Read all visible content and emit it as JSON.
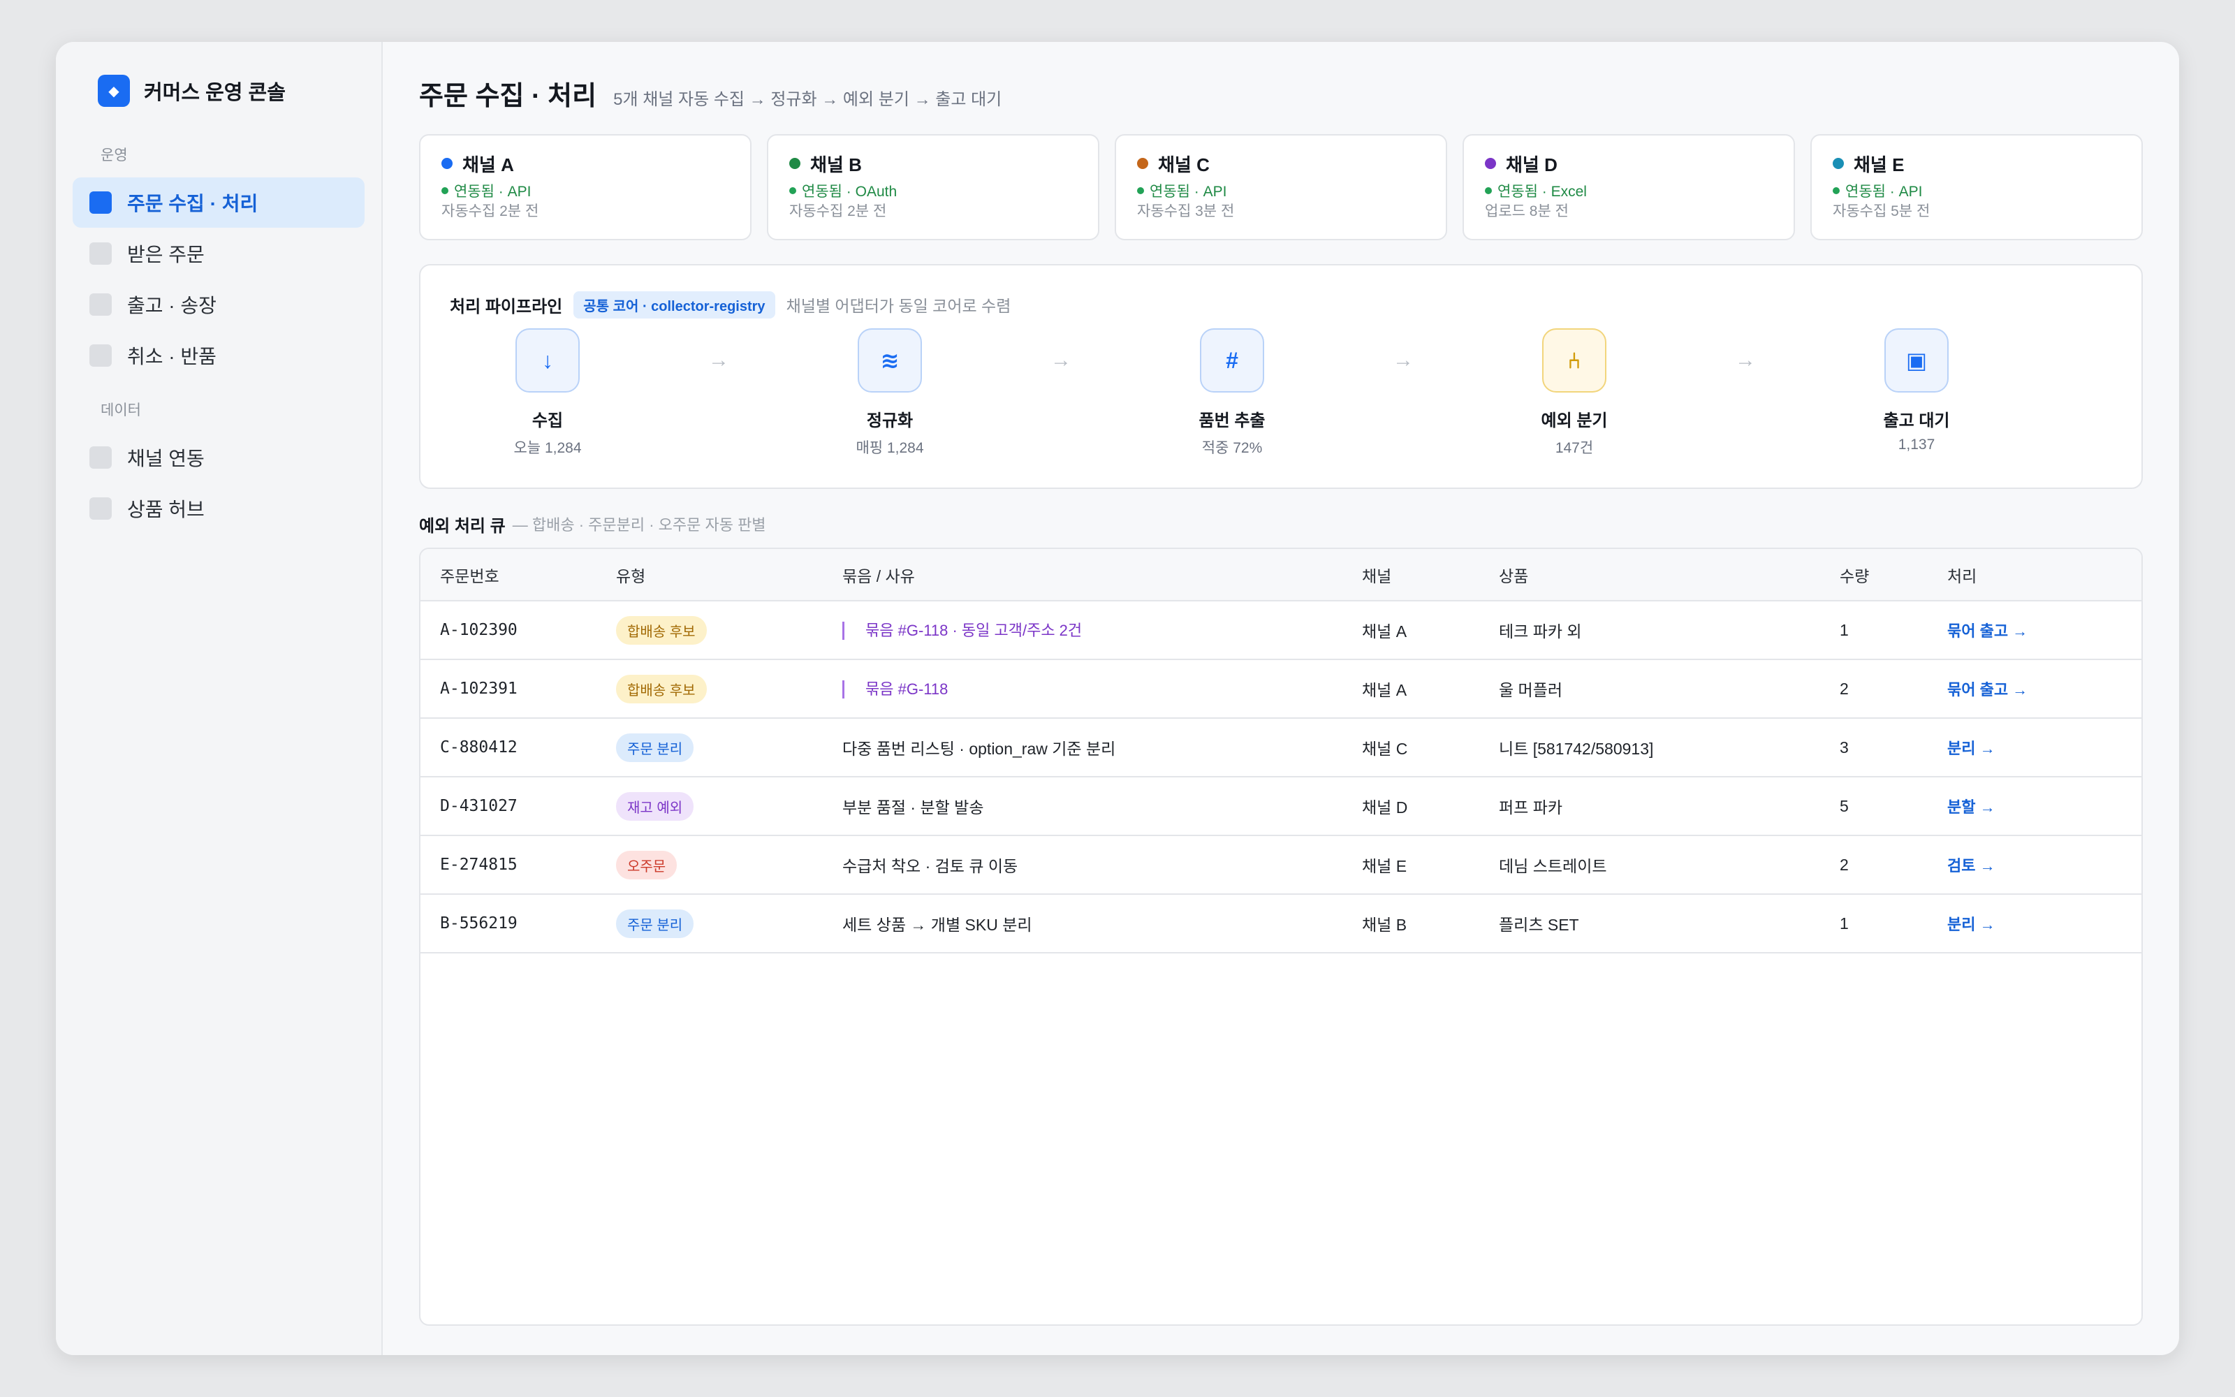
{
  "app": {
    "name": "커머스 운영 콘솔",
    "logo_glyph": "◆"
  },
  "sidebar": {
    "groups": [
      {
        "label": "운영",
        "items": [
          {
            "label": "주문 수집 · 처리",
            "active": true
          },
          {
            "label": "받은 주문",
            "active": false
          },
          {
            "label": "출고 · 송장",
            "active": false
          },
          {
            "label": "취소 · 반품",
            "active": false
          }
        ]
      },
      {
        "label": "데이터",
        "items": [
          {
            "label": "채널 연동",
            "active": false
          },
          {
            "label": "상품 허브",
            "active": false
          }
        ]
      }
    ]
  },
  "header": {
    "title": "주문 수집 · 처리",
    "subtitle": "5개 채널 자동 수집 → 정규화 → 예외 분기 → 출고 대기"
  },
  "channels": [
    {
      "name": "채널 A",
      "color": "#1a6cf2",
      "status": "연동됨 · API",
      "time": "자동수집 2분 전"
    },
    {
      "name": "채널 B",
      "color": "#1f8a45",
      "status": "연동됨 · OAuth",
      "time": "자동수집 2분 전"
    },
    {
      "name": "채널 C",
      "color": "#c4661a",
      "status": "연동됨 · API",
      "time": "자동수집 3분 전"
    },
    {
      "name": "채널 D",
      "color": "#7b35c7",
      "status": "연동됨 · Excel",
      "time": "업로드 8분 전"
    },
    {
      "name": "채널 E",
      "color": "#1a8fb5",
      "status": "연동됨 · API",
      "time": "자동수집 5분 전"
    }
  ],
  "pipeline": {
    "title": "처리 파이프라인",
    "tag": "공통 코어 · collector-registry",
    "desc": "채널별 어댑터가 동일 코어로 수렴",
    "arrow_glyph": "→",
    "stages": [
      {
        "label": "수집",
        "sub": "오늘 1,284",
        "icon": "download-icon",
        "glyph": "↓"
      },
      {
        "label": "정규화",
        "sub": "매핑 1,284",
        "icon": "normalize-icon",
        "glyph": "≋"
      },
      {
        "label": "품번 추출",
        "sub": "적중 72%",
        "icon": "hash-icon",
        "glyph": "#"
      },
      {
        "label": "예외 분기",
        "sub": "147건",
        "icon": "branch-icon",
        "glyph": "⑃"
      },
      {
        "label": "출고 대기",
        "sub": "1,137",
        "icon": "box-icon",
        "glyph": "▣"
      }
    ]
  },
  "queue": {
    "title": "예외 처리 큐",
    "subtitle": "— 합배송 · 주문분리 · 오주문 자동 판별",
    "columns": [
      "주문번호",
      "유형",
      "묶음 / 사유",
      "채널",
      "상품",
      "수량",
      "처리"
    ],
    "rows": [
      {
        "id": "A-102390",
        "type": "합배송 후보",
        "type_style": "yellow",
        "reason": "묶음 #G-118 · 동일 고객/주소 2건",
        "grouped": true,
        "channel": "채널 A",
        "product": "테크 파카 외",
        "qty": "1",
        "action": "묶어 출고 →"
      },
      {
        "id": "A-102391",
        "type": "합배송 후보",
        "type_style": "yellow",
        "reason": "묶음 #G-118",
        "grouped": true,
        "channel": "채널 A",
        "product": "울 머플러",
        "qty": "2",
        "action": "묶어 출고 →"
      },
      {
        "id": "C-880412",
        "type": "주문 분리",
        "type_style": "blue",
        "reason": "다중 품번 리스팅 · option_raw 기준 분리",
        "grouped": false,
        "channel": "채널 C",
        "product": "니트 [581742/580913]",
        "qty": "3",
        "action": "분리 →"
      },
      {
        "id": "D-431027",
        "type": "재고 예외",
        "type_style": "purple",
        "reason": "부분 품절 · 분할 발송",
        "grouped": false,
        "channel": "채널 D",
        "product": "퍼프 파카",
        "qty": "5",
        "action": "분할 →"
      },
      {
        "id": "E-274815",
        "type": "오주문",
        "type_style": "red",
        "reason": "수급처 착오 · 검토 큐 이동",
        "grouped": false,
        "channel": "채널 E",
        "product": "데님 스트레이트",
        "qty": "2",
        "action": "검토 →"
      },
      {
        "id": "B-556219",
        "type": "주문 분리",
        "type_style": "blue",
        "reason": "세트 상품 → 개별 SKU 분리",
        "grouped": false,
        "channel": "채널 B",
        "product": "플리츠 SET",
        "qty": "1",
        "action": "분리 →"
      }
    ]
  }
}
